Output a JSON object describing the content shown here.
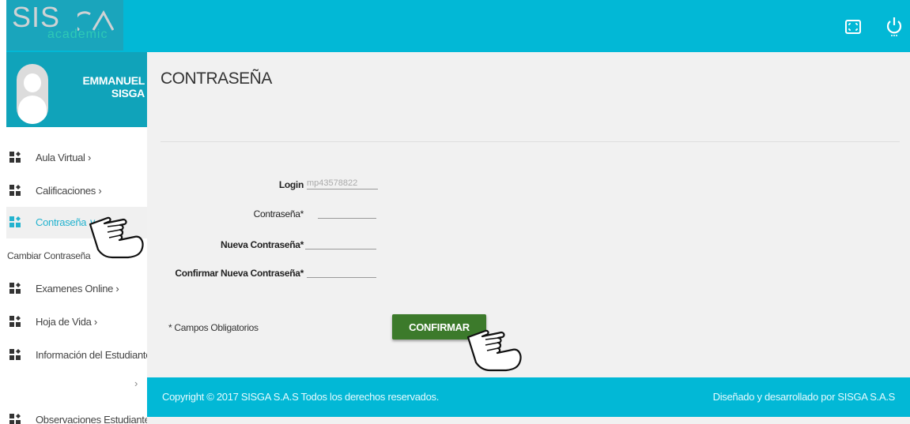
{
  "brand": {
    "logo_main": "SIS",
    "logo_sub": "academic",
    "colors": {
      "header": "#02b8d6",
      "profile": "#10a3ba",
      "button": "#3c7a2b",
      "active_link": "#23b3cf"
    }
  },
  "header": {
    "icons": [
      "expand-icon",
      "power-icon"
    ]
  },
  "profile": {
    "name": "EMMANUEL SISGA"
  },
  "sidebar": {
    "items": [
      {
        "label": "Aula Virtual ›"
      },
      {
        "label": "Calificaciones ›"
      },
      {
        "label": "Contraseña ∨"
      },
      {
        "label": "Examenes Online ›"
      },
      {
        "label": "Hoja de Vida ›"
      },
      {
        "label": "Información del Estudiante"
      },
      {
        "label": "Observaciones Estudiante"
      }
    ],
    "submenu_label": "Cambiar Contraseña",
    "orphan_arrow": "›"
  },
  "main": {
    "title": "CONTRASEÑA",
    "form": {
      "login_label": "Login",
      "login_value": "mp43578822",
      "password_label": "Contraseña*",
      "new_password_label": "Nueva Contraseña*",
      "confirm_password_label": "Confirmar Nueva Contraseña*"
    },
    "required_note": "* Campos Obligatorios",
    "confirm_button": "CONFIRMAR"
  },
  "footer": {
    "left": "Copyright © 2017 SISGA S.A.S Todos los derechos reservados.",
    "right": "Diseñado y desarrollado por SISGA S.A.S"
  }
}
